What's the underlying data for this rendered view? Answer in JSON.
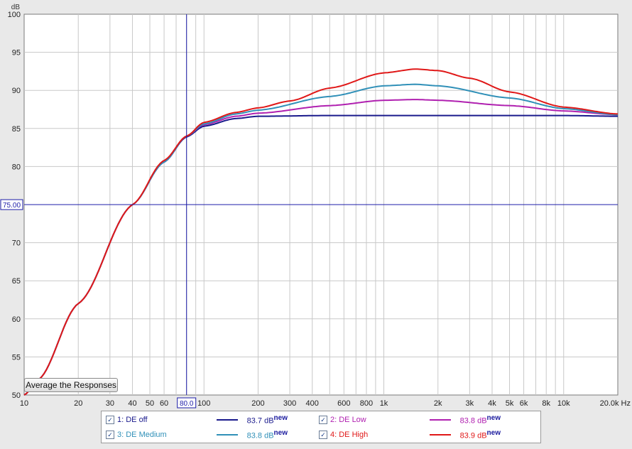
{
  "chart_data": {
    "type": "line",
    "xscale": "log",
    "xlim": [
      10,
      20000
    ],
    "ylim": [
      50,
      100
    ],
    "grid": true,
    "yunit": "dB",
    "xunit": "Hz",
    "y_ticks": [
      50,
      55,
      60,
      65,
      70,
      75,
      80,
      85,
      90,
      95,
      100
    ],
    "x_tick_labels": [
      {
        "v": 10,
        "t": "10"
      },
      {
        "v": 20,
        "t": "20"
      },
      {
        "v": 30,
        "t": "30"
      },
      {
        "v": 40,
        "t": "40"
      },
      {
        "v": 50,
        "t": "50"
      },
      {
        "v": 60,
        "t": "60"
      },
      {
        "v": 100,
        "t": "100"
      },
      {
        "v": 200,
        "t": "200"
      },
      {
        "v": 300,
        "t": "300"
      },
      {
        "v": 400,
        "t": "400"
      },
      {
        "v": 600,
        "t": "600"
      },
      {
        "v": 800,
        "t": "800"
      },
      {
        "v": 1000,
        "t": "1k"
      },
      {
        "v": 2000,
        "t": "2k"
      },
      {
        "v": 3000,
        "t": "3k"
      },
      {
        "v": 4000,
        "t": "4k"
      },
      {
        "v": 5000,
        "t": "5k"
      },
      {
        "v": 6000,
        "t": "6k"
      },
      {
        "v": 8000,
        "t": "8k"
      },
      {
        "v": 10000,
        "t": "10k"
      },
      {
        "v": 20000,
        "t": "20.0k Hz"
      }
    ],
    "cursor": {
      "x": 80,
      "y": 75,
      "x_label": "80.0",
      "y_label": "75.00"
    },
    "series": [
      {
        "name": "1: DE off",
        "color": "#1a1a8c",
        "x": [
          10,
          12,
          20,
          40,
          60,
          80,
          100,
          150,
          200,
          500,
          1000,
          2000,
          5000,
          10000,
          20000
        ],
        "y": [
          50.0,
          52.0,
          62.0,
          75.0,
          80.6,
          83.9,
          85.3,
          86.3,
          86.6,
          86.7,
          86.7,
          86.7,
          86.7,
          86.7,
          86.6
        ]
      },
      {
        "name": "2: DE Low",
        "color": "#b020b0",
        "x": [
          10,
          12,
          20,
          40,
          60,
          80,
          100,
          150,
          200,
          500,
          1000,
          1500,
          2000,
          5000,
          10000,
          20000
        ],
        "y": [
          50.0,
          52.0,
          62.0,
          75.0,
          80.6,
          84.0,
          85.5,
          86.6,
          87.0,
          88.0,
          88.7,
          88.8,
          88.7,
          88.0,
          87.3,
          86.8
        ]
      },
      {
        "name": "3: DE Medium",
        "color": "#3090b8",
        "x": [
          10,
          12,
          20,
          40,
          60,
          80,
          100,
          150,
          200,
          500,
          1000,
          1500,
          2000,
          5000,
          10000,
          20000
        ],
        "y": [
          50.0,
          52.0,
          62.0,
          75.0,
          80.6,
          84.0,
          85.6,
          86.9,
          87.4,
          89.2,
          90.6,
          90.8,
          90.6,
          89.0,
          87.6,
          86.8
        ]
      },
      {
        "name": "4: DE High",
        "color": "#e01818",
        "x": [
          10,
          12,
          20,
          40,
          60,
          80,
          100,
          150,
          200,
          300,
          500,
          1000,
          1500,
          2000,
          3000,
          5000,
          10000,
          20000
        ],
        "y": [
          50.0,
          52.0,
          62.0,
          75.0,
          80.8,
          84.0,
          85.8,
          87.1,
          87.7,
          88.6,
          90.3,
          92.3,
          92.8,
          92.6,
          91.6,
          89.8,
          87.8,
          86.9
        ]
      }
    ]
  },
  "button": {
    "label": "Average the Responses"
  },
  "legend": {
    "items": [
      {
        "checked": "✓",
        "name": "1: DE off",
        "value": "83.7 dB",
        "sup": "new",
        "color": "#1a1a8c",
        "name_color": "#1a1a8c"
      },
      {
        "checked": "✓",
        "name": "2: DE Low",
        "value": "83.8 dB",
        "sup": "new",
        "color": "#b020b0",
        "name_color": "#b020b0"
      },
      {
        "checked": "✓",
        "name": "3: DE Medium",
        "value": "83.8 dB",
        "sup": "new",
        "color": "#3090b8",
        "name_color": "#3090b8"
      },
      {
        "checked": "✓",
        "name": "4: DE High",
        "value": "83.9 dB",
        "sup": "new",
        "color": "#e01818",
        "name_color": "#e01818"
      }
    ]
  }
}
